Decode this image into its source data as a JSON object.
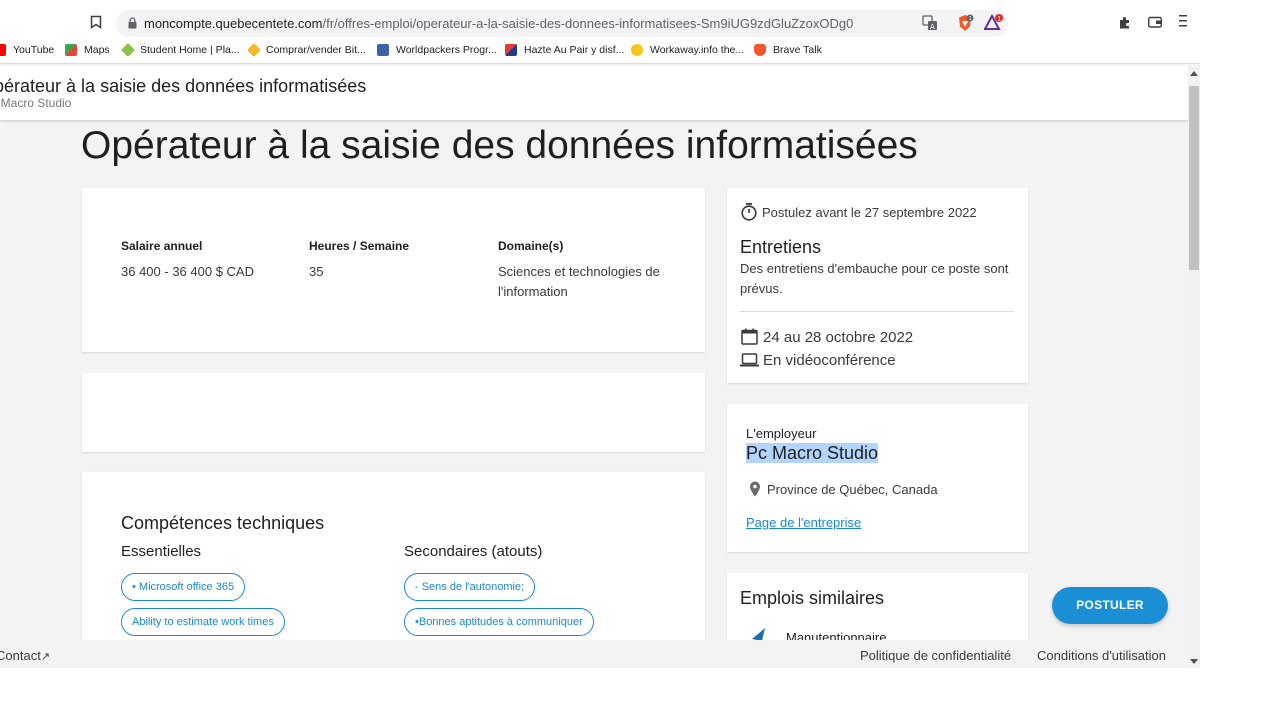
{
  "browser": {
    "url_host": "moncompte.quebecentete.com",
    "url_path": "/fr/offres-emploi/operateur-a-la-saisie-des-donnees-informatisees-Sm9iUG9zdGluZzoxODg0",
    "bookmarks": [
      "YouTube",
      "Maps",
      "Student Home | Pla...",
      "Comprar/vender Bit...",
      "Worldpackers Progr...",
      "Hazte Au Pair y disf...",
      "Workaway.info the...",
      "Brave Talk"
    ],
    "badge_count": "1"
  },
  "sticky": {
    "title": "pérateur à la saisie des données informatisées",
    "company": ": Macro Studio"
  },
  "job": {
    "title": "Opérateur à la saisie des données informatisées",
    "salary_label": "Salaire annuel",
    "salary_value": "36 400 - 36 400 $ CAD",
    "hours_label": "Heures / Semaine",
    "hours_value": "35",
    "domain_label": "Domaine(s)",
    "domain_value": "Sciences et technologies de l'information"
  },
  "skills": {
    "heading": "Compétences techniques",
    "essential_heading": "Essentielles",
    "essential": [
      "• Microsoft office 365",
      "Ability to estimate work times"
    ],
    "secondary_heading": "Secondaires (atouts)",
    "secondary": [
      "- Sens de l'autonomie;",
      "•Bonnes aptitudes à communiquer"
    ]
  },
  "interviews": {
    "deadline": "Postulez avant le 27 septembre 2022",
    "heading": "Entretiens",
    "description": "Des entretiens d'embauche pour ce poste sont prévus.",
    "dates": "24 au 28 octobre 2022",
    "mode": "En vidéoconférence"
  },
  "employer": {
    "label": "L'employeur",
    "name": "Pc Macro Studio",
    "location": "Province de Québec, Canada",
    "page_link": "Page de l'entreprise"
  },
  "similar": {
    "heading": "Emplois similaires",
    "first_item": "Manutentionnaire"
  },
  "apply_button": "POSTULER",
  "footer": {
    "contact": "Contact",
    "privacy": "Politique de confidentialité",
    "terms": "Conditions d'utilisation"
  },
  "colors": {
    "accent": "#1b8fd6",
    "page_bg": "#f3f3f3",
    "selection": "#b3d4fc"
  }
}
